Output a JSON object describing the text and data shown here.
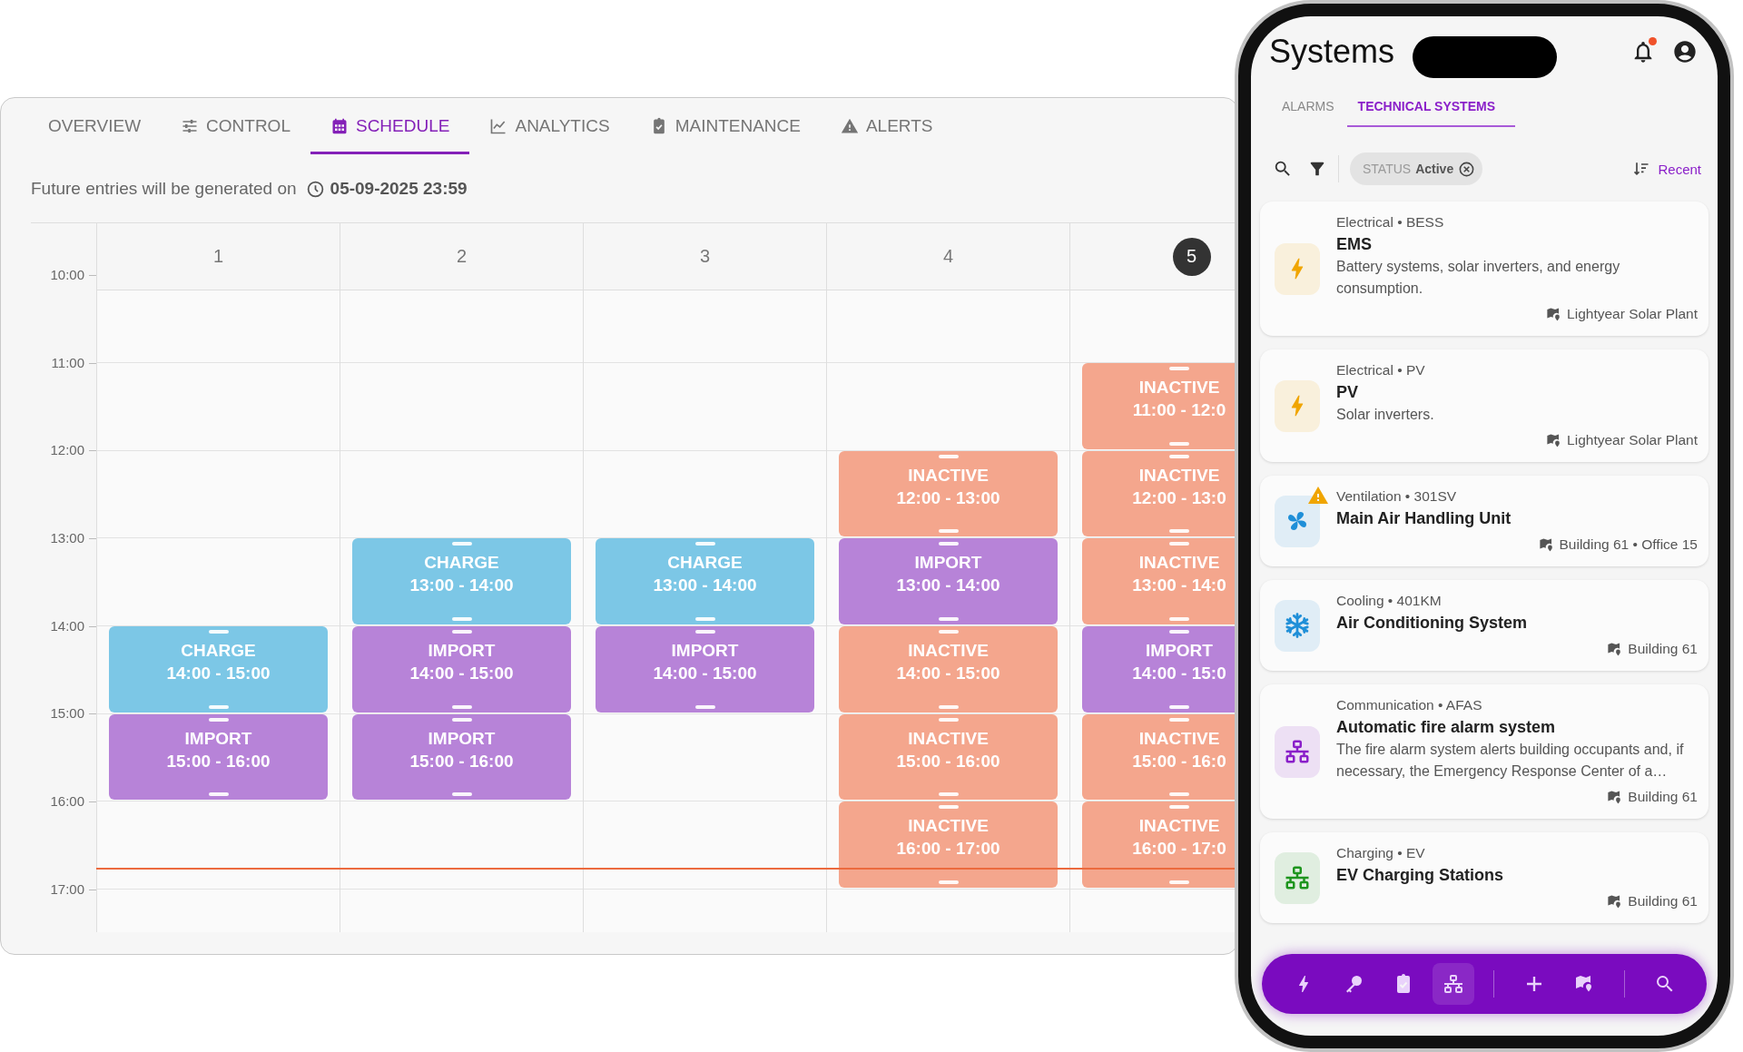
{
  "tabs": [
    {
      "label": "OVERVIEW",
      "kind": "none",
      "selected": false
    },
    {
      "label": "CONTROL",
      "kind": "sliders",
      "selected": false
    },
    {
      "label": "SCHEDULE",
      "kind": "calendar",
      "selected": true
    },
    {
      "label": "ANALYTICS",
      "kind": "chart",
      "selected": false
    },
    {
      "label": "MAINTENANCE",
      "kind": "clipboard",
      "selected": false
    },
    {
      "label": "ALERTS",
      "kind": "warning",
      "selected": false
    }
  ],
  "generation_note": {
    "text": "Future entries will be generated on",
    "datetime": "05-09-2025 23:59"
  },
  "schedule": {
    "hours": [
      "10:00",
      "11:00",
      "12:00",
      "13:00",
      "14:00",
      "15:00",
      "16:00",
      "17:00"
    ],
    "days": [
      {
        "label": "1",
        "selected": false,
        "slots": [
          {
            "kind": "empty"
          },
          {
            "kind": "empty"
          },
          {
            "kind": "empty"
          },
          {
            "kind": "empty"
          },
          {
            "kind": "charge",
            "label": "CHARGE",
            "time": "14:00 - 15:00"
          },
          {
            "kind": "import",
            "label": "IMPORT",
            "time": "15:00 - 16:00"
          },
          {
            "kind": "empty"
          }
        ]
      },
      {
        "label": "2",
        "selected": false,
        "slots": [
          {
            "kind": "empty"
          },
          {
            "kind": "empty"
          },
          {
            "kind": "empty"
          },
          {
            "kind": "charge",
            "label": "CHARGE",
            "time": "13:00 - 14:00"
          },
          {
            "kind": "import",
            "label": "IMPORT",
            "time": "14:00 - 15:00"
          },
          {
            "kind": "import",
            "label": "IMPORT",
            "time": "15:00 - 16:00"
          },
          {
            "kind": "empty"
          }
        ]
      },
      {
        "label": "3",
        "selected": false,
        "slots": [
          {
            "kind": "empty"
          },
          {
            "kind": "empty"
          },
          {
            "kind": "empty"
          },
          {
            "kind": "charge",
            "label": "CHARGE",
            "time": "13:00 - 14:00"
          },
          {
            "kind": "import",
            "label": "IMPORT",
            "time": "14:00 - 15:00"
          },
          {
            "kind": "empty"
          },
          {
            "kind": "empty"
          }
        ]
      },
      {
        "label": "4",
        "selected": false,
        "slots": [
          {
            "kind": "empty"
          },
          {
            "kind": "empty"
          },
          {
            "kind": "inactive",
            "label": "INACTIVE",
            "time": "12:00 - 13:00"
          },
          {
            "kind": "import",
            "label": "IMPORT",
            "time": "13:00 - 14:00"
          },
          {
            "kind": "inactive",
            "label": "INACTIVE",
            "time": "14:00 - 15:00"
          },
          {
            "kind": "inactive",
            "label": "INACTIVE",
            "time": "15:00 - 16:00"
          },
          {
            "kind": "inactive",
            "label": "INACTIVE",
            "time": "16:00 - 17:00"
          }
        ]
      },
      {
        "label": "5",
        "selected": true,
        "slots": [
          {
            "kind": "empty"
          },
          {
            "kind": "inactive",
            "label": "INACTIVE",
            "time": "11:00 - 12:0"
          },
          {
            "kind": "inactive",
            "label": "INACTIVE",
            "time": "12:00 - 13:0"
          },
          {
            "kind": "inactive",
            "label": "INACTIVE",
            "time": "13:00 - 14:0"
          },
          {
            "kind": "import",
            "label": "IMPORT",
            "time": "14:00 - 15:0"
          },
          {
            "kind": "inactive",
            "label": "INACTIVE",
            "time": "15:00 - 16:0"
          },
          {
            "kind": "inactive",
            "label": "INACTIVE",
            "time": "16:00 - 17:0"
          }
        ]
      }
    ]
  },
  "phone": {
    "title": "Systems",
    "notifications_unread": true,
    "tabs": [
      {
        "label": "ALARMS",
        "selected": false
      },
      {
        "label": "TECHNICAL SYSTEMS",
        "selected": true
      }
    ],
    "filter_chip": {
      "label": "STATUS",
      "value": "Active"
    },
    "sort": {
      "label": "Recent"
    },
    "systems": [
      {
        "category": "Electrical • BESS",
        "title": "EMS",
        "description": "Battery systems, solar inverters, and energy consumption.",
        "location": "Lightyear Solar Plant",
        "kind": "bolt",
        "color": "#f0a500",
        "warning": false
      },
      {
        "category": "Electrical • PV",
        "title": "PV",
        "description": "Solar inverters.",
        "location": "Lightyear Solar Plant",
        "kind": "bolt",
        "color": "#f0a500",
        "warning": false
      },
      {
        "category": "Ventilation • 301SV",
        "title": "Main Air Handling Unit",
        "location": "Building 61 • Office 15",
        "kind": "fan",
        "color": "#1f8fd8",
        "warning": true
      },
      {
        "category": "Cooling • 401KM",
        "title": "Air Conditioning System",
        "location": "Building 61",
        "kind": "snowflake",
        "color": "#1f8fd8",
        "warning": false
      },
      {
        "category": "Communication • AFAS",
        "title": "Automatic fire alarm system",
        "description": "The fire alarm system alerts building occupants and, if necessary, the Emergency Response Center of a…",
        "location": "Building 61",
        "kind": "network",
        "color": "#8a1fc9",
        "warning": false
      },
      {
        "category": "Charging • EV",
        "title": "EV Charging Stations",
        "location": "Building 61",
        "kind": "network",
        "color": "#1e951e",
        "warning": false
      }
    ],
    "nav": [
      [
        {
          "kind": "bolt",
          "selected": false
        },
        {
          "kind": "key",
          "selected": false
        },
        {
          "kind": "clipboard",
          "selected": false
        },
        {
          "kind": "network",
          "selected": true
        }
      ],
      [
        {
          "kind": "plus",
          "selected": false
        },
        {
          "kind": "map",
          "selected": false
        }
      ],
      [
        {
          "kind": "search",
          "selected": false
        }
      ]
    ]
  }
}
